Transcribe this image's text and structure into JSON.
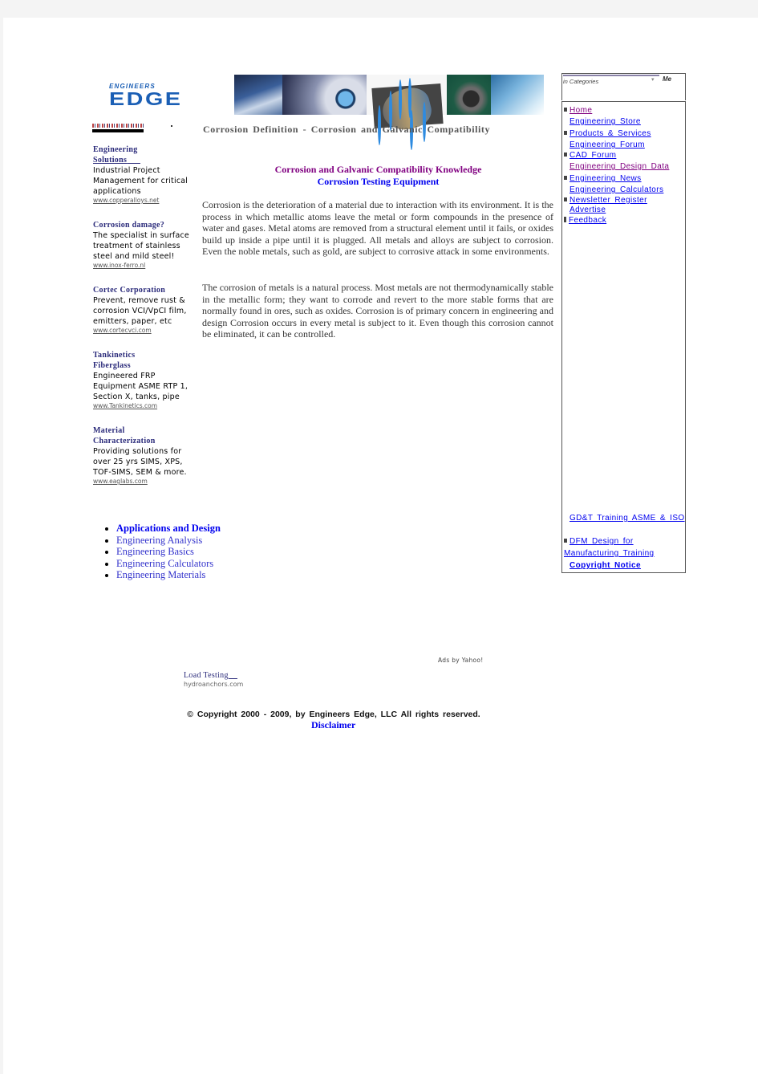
{
  "header": {
    "logo_top": "ENGINEERS",
    "logo_main": "EDGE",
    "banner_alt": "engineering-banner"
  },
  "search": {
    "category_value": "in Categories",
    "button_label": "Me"
  },
  "page_title": "Corrosion Definition - Corrosion and Galvanic Compatibility",
  "content": {
    "link_knowledge": "Corrosion and Galvanic Compatibility Knowledge",
    "link_testing": "Corrosion Testing Equipment",
    "paragraphs": [
      "Corrosion is the deterioration of a material due to interaction with its environment. It is the process in which metallic atoms leave the metal or form compounds in the presence of water and gases. Metal atoms are removed from a structural element until it fails, or oxides build up inside a pipe until it is plugged. All metals and alloys are subject to corrosion. Even the noble metals, such as gold, are subject to corrosive attack in some environments.",
      "The corrosion of metals is a natural process. Most metals are not thermodynamically stable in the metallic form; they want to corrode and revert to the more stable forms that are normally found in ores, such as oxides. Corrosion is of primary concern in engineering and design Corrosion occurs in every metal is subject to it. Even though this corrosion cannot be eliminated, it can be controlled."
    ]
  },
  "left_ads": [
    {
      "title_line1": "Engineering",
      "title_line2": "Solutions",
      "description": "Industrial Project Management for critical applications",
      "url": "www.copperalloys.net"
    },
    {
      "title_line1": "Corrosion damage?",
      "title_line2": "",
      "description": "The specialist in surface treatment of stainless steel and mild steel!",
      "url": "www.inox-ferro.nl"
    },
    {
      "title_line1": "Cortec Corporation",
      "title_line2": "",
      "description": "Prevent, remove rust & corrosion VCI/VpCI film, emitters, paper, etc",
      "url": "www.cortecvci.com"
    },
    {
      "title_line1": "Tankinetics",
      "title_line2": "Fiberglass",
      "description": "Engineered FRP Equipment ASME RTP 1, Section X, tanks, pipe",
      "url": "www.Tankinetics.com"
    },
    {
      "title_line1": "Material",
      "title_line2": "Characterization",
      "description": "Providing solutions for over 25 yrs SIMS, XPS, TOF-SIMS, SEM & more.",
      "url": "www.eaglabs.com"
    }
  ],
  "left_nav": [
    {
      "label": "Applications and Design",
      "bold": true
    },
    {
      "label": "Engineering Analysis",
      "bold": false
    },
    {
      "label": "Engineering Basics",
      "bold": false
    },
    {
      "label": "Engineering Calculators",
      "bold": false
    },
    {
      "label": "Engineering Materials",
      "bold": false
    }
  ],
  "right_nav": {
    "items": [
      {
        "label": "Home",
        "bullet": true,
        "visited": true
      },
      {
        "label": "Engineering Store",
        "bullet": false,
        "visited": false
      },
      {
        "label": "Products & Services",
        "bullet": true,
        "visited": false
      },
      {
        "label": "Engineering Forum",
        "bullet": false,
        "visited": false
      },
      {
        "label": "CAD Forum",
        "bullet": true,
        "visited": false
      },
      {
        "label": "Engineering Design Data",
        "bullet": false,
        "visited": true
      },
      {
        "label": "Engineering News",
        "bullet": true,
        "visited": false
      },
      {
        "label": "Engineering Calculators",
        "bullet": false,
        "visited": false
      },
      {
        "label": "Newsletter Register",
        "bullet": true,
        "visited": false
      },
      {
        "label": "Advertise",
        "bullet": false,
        "visited": false
      },
      {
        "label": "Feedback",
        "bullet": true,
        "visited": false
      }
    ],
    "gdt": "GD&T Training ASME & ISO",
    "dfm_line1": "DFM Design for",
    "dfm_line2": "Manufacturing Training",
    "copyright_notice": "Copyright Notice"
  },
  "bottom_ads": {
    "provider": "Ads by Yahoo!",
    "title": "Load Testing",
    "url": "hydroanchors.com"
  },
  "footer": {
    "copyright": "© Copyright 2000 - 2009, by Engineers Edge, LLC All rights reserved.",
    "disclaimer": "Disclaimer"
  }
}
